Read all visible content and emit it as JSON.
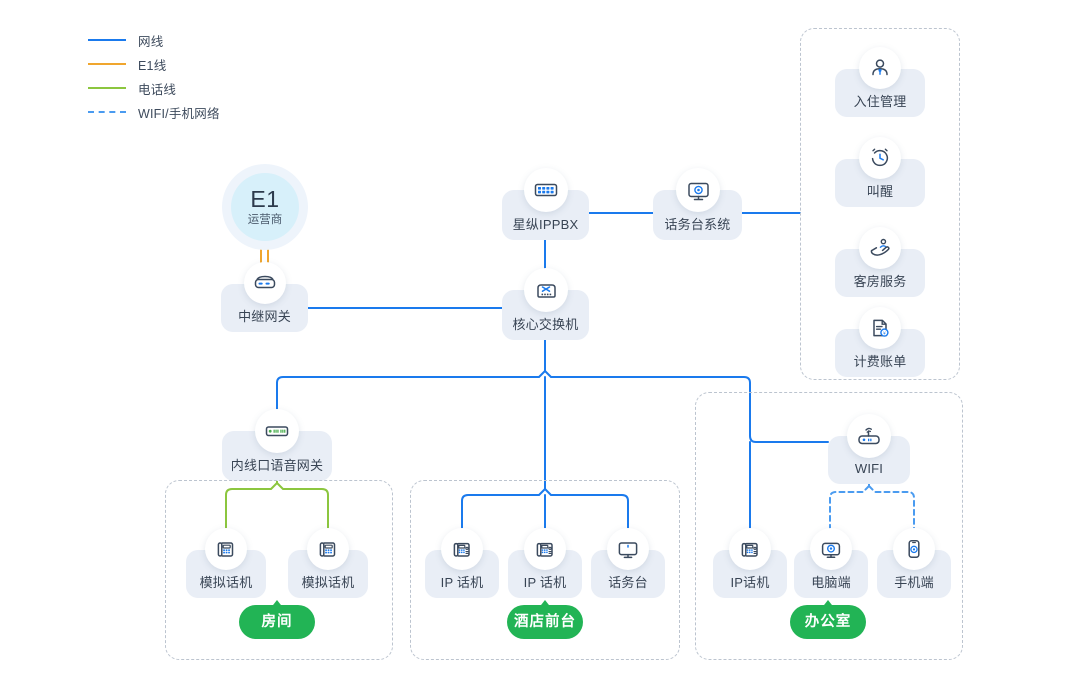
{
  "legend": {
    "items": [
      {
        "label": "网线",
        "color": "#1a7aed",
        "style": "solid",
        "icon": "line-solid-icon"
      },
      {
        "label": "E1线",
        "color": "#f0a62e",
        "style": "solid",
        "icon": "line-solid-icon"
      },
      {
        "label": "电话线",
        "color": "#8cc63f",
        "style": "solid",
        "icon": "line-solid-icon"
      },
      {
        "label": "WIFI/手机网络",
        "color": "#4a9bf0",
        "style": "dashed",
        "icon": "line-dashed-icon"
      }
    ]
  },
  "nodes": {
    "e1": {
      "title": "E1",
      "subtitle": "运营商"
    },
    "trunk_gateway": {
      "label": "中继网关",
      "icon": "gateway-device-icon"
    },
    "ippbx": {
      "label": "星纵IPPBX",
      "icon": "pbx-rack-icon"
    },
    "operator_console_system": {
      "label": "话务台系统",
      "icon": "console-monitor-icon"
    },
    "core_switch": {
      "label": "核心交换机",
      "icon": "switch-icon"
    },
    "voice_gateway": {
      "label": "内线口语音网关",
      "icon": "voice-gateway-icon"
    },
    "wifi": {
      "label": "WIFI",
      "icon": "wifi-router-icon"
    }
  },
  "services_panel": {
    "items": [
      {
        "label": "入住管理",
        "icon": "check-in-person-icon"
      },
      {
        "label": "叫醒",
        "icon": "alarm-clock-icon"
      },
      {
        "label": "客房服务",
        "icon": "room-service-hand-icon"
      },
      {
        "label": "计费账单",
        "icon": "billing-invoice-icon"
      }
    ]
  },
  "zones": [
    {
      "badge": "房间",
      "devices": [
        {
          "label": "模拟话机",
          "icon": "analog-phone-icon"
        },
        {
          "label": "模拟话机",
          "icon": "analog-phone-icon"
        }
      ]
    },
    {
      "badge": "酒店前台",
      "devices": [
        {
          "label": "IP 话机",
          "icon": "ip-phone-icon"
        },
        {
          "label": "IP 话机",
          "icon": "ip-phone-icon"
        },
        {
          "label": "话务台",
          "icon": "monitor-icon"
        }
      ]
    },
    {
      "badge": "办公室",
      "devices": [
        {
          "label": "IP话机",
          "icon": "ip-phone-icon"
        },
        {
          "label": "电脑端",
          "icon": "desktop-client-icon"
        },
        {
          "label": "手机端",
          "icon": "mobile-client-icon"
        }
      ]
    }
  ],
  "colors": {
    "network_line": "#1a7aed",
    "e1_line": "#f0a62e",
    "phone_line": "#8cc63f",
    "wifi_line": "#4a9bf0",
    "zone_green": "#22b455",
    "card_bg": "#e9eef6"
  }
}
